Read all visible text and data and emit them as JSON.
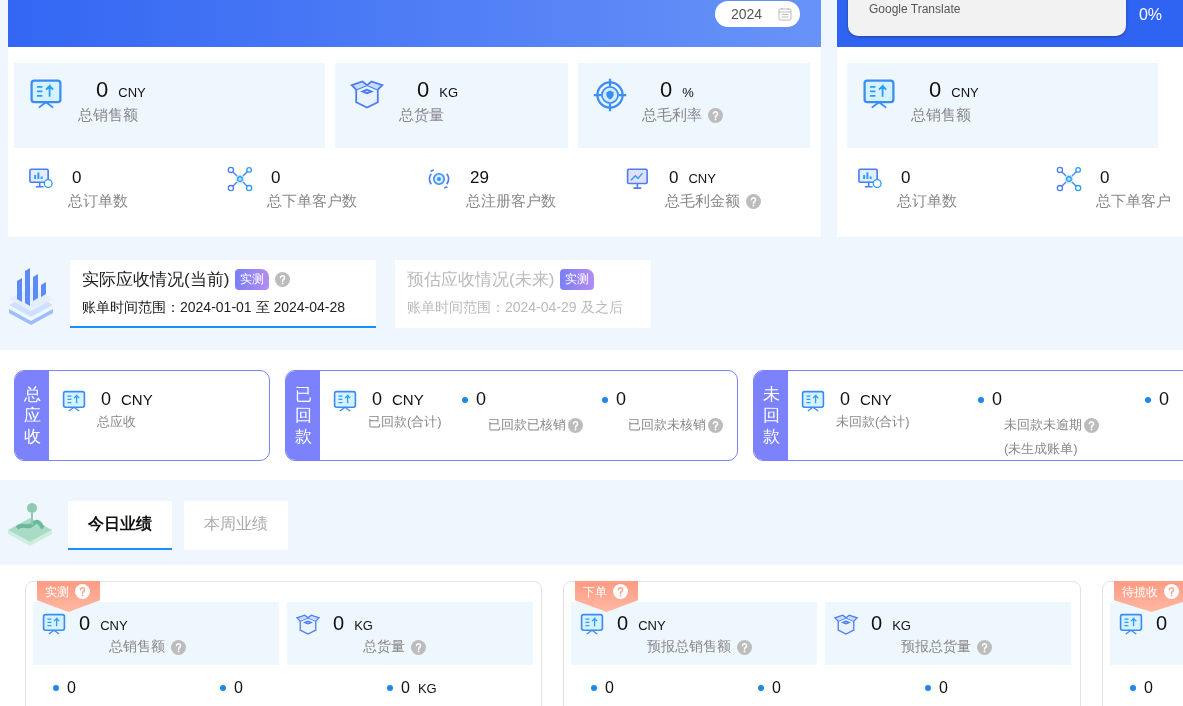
{
  "header": {
    "year": "2024",
    "percent": "0%"
  },
  "translate_popup": {
    "label": "Google Translate"
  },
  "overview_left": {
    "cards": [
      {
        "kind": "sales",
        "value": "0",
        "unit": "CNY",
        "label": "总销售额"
      },
      {
        "kind": "cargo",
        "value": "0",
        "unit": "KG",
        "label": "总货量"
      },
      {
        "kind": "margin",
        "value": "0",
        "unit": "%",
        "label": "总毛利率",
        "help": true
      }
    ],
    "stats": [
      {
        "kind": "orders",
        "value": "0",
        "label": "总订单数"
      },
      {
        "kind": "customers",
        "value": "0",
        "label": "总下单客户数"
      },
      {
        "kind": "registered",
        "value": "29",
        "label": "总注册客户数"
      },
      {
        "kind": "profit",
        "value": "0",
        "unit": "CNY",
        "label": "总毛利金额",
        "help": true
      }
    ]
  },
  "overview_right": {
    "cards": [
      {
        "kind": "sales",
        "value": "0",
        "unit": "CNY",
        "label": "总销售额"
      }
    ],
    "stats": [
      {
        "kind": "orders",
        "value": "0",
        "label": "总订单数"
      },
      {
        "kind": "customers",
        "value": "0",
        "label": "总下单客户"
      }
    ]
  },
  "receivable_tabs": [
    {
      "title": "实际应收情况(当前)",
      "badge": "实测",
      "help": true,
      "range": "账单时间范围：2024-01-01 至 2024-04-28",
      "selected": true
    },
    {
      "title": "预估应收情况(未来)",
      "badge": "实测",
      "range": "账单时间范围：2024-04-29 及之后",
      "selected": false
    }
  ],
  "receivable_cards": [
    {
      "side": "总应收",
      "items": [
        {
          "kind": "main",
          "value": "0",
          "unit": "CNY",
          "label": "总应收"
        }
      ]
    },
    {
      "side": "已回款",
      "items": [
        {
          "kind": "main",
          "value": "0",
          "unit": "CNY",
          "label": "已回款(合计)"
        },
        {
          "kind": "dot",
          "value": "0",
          "label": "已回款已核销",
          "help": true
        },
        {
          "kind": "dot",
          "value": "0",
          "label": "已回款未核销",
          "help": true
        }
      ]
    },
    {
      "side": "未回款",
      "items": [
        {
          "kind": "main",
          "value": "0",
          "unit": "CNY",
          "label": "未回款(合计)"
        },
        {
          "kind": "dot",
          "value": "0",
          "label": "未回款未逾期",
          "help": true,
          "note": "(未生成账单)"
        },
        {
          "kind": "dot",
          "value": "0"
        }
      ]
    }
  ],
  "performance_tabs": [
    {
      "label": "今日业绩",
      "selected": true
    },
    {
      "label": "本周业绩",
      "selected": false
    }
  ],
  "performance_cards": [
    {
      "badge": "实测",
      "badge_help": true,
      "metrics": [
        {
          "kind": "sales",
          "value": "0",
          "unit": "CNY",
          "label": "总销售额",
          "help": true
        },
        {
          "kind": "cargo",
          "value": "0",
          "unit": "KG",
          "label": "总货量",
          "help": true
        }
      ],
      "stats": [
        {
          "value": "0"
        },
        {
          "value": "0"
        },
        {
          "value": "0",
          "unit": "KG"
        }
      ]
    },
    {
      "badge": "下单",
      "badge_help": true,
      "metrics": [
        {
          "kind": "sales",
          "value": "0",
          "unit": "CNY",
          "label": "预报总销售额",
          "help": true
        },
        {
          "kind": "cargo",
          "value": "0",
          "unit": "KG",
          "label": "预报总货量",
          "help": true
        }
      ],
      "stats": [
        {
          "value": "0"
        },
        {
          "value": "0"
        },
        {
          "value": "0"
        }
      ]
    },
    {
      "badge": "待揽收",
      "badge_help": true,
      "metrics": [
        {
          "kind": "sales",
          "value": "0"
        }
      ],
      "stats": [
        {
          "value": "0"
        }
      ]
    }
  ]
}
